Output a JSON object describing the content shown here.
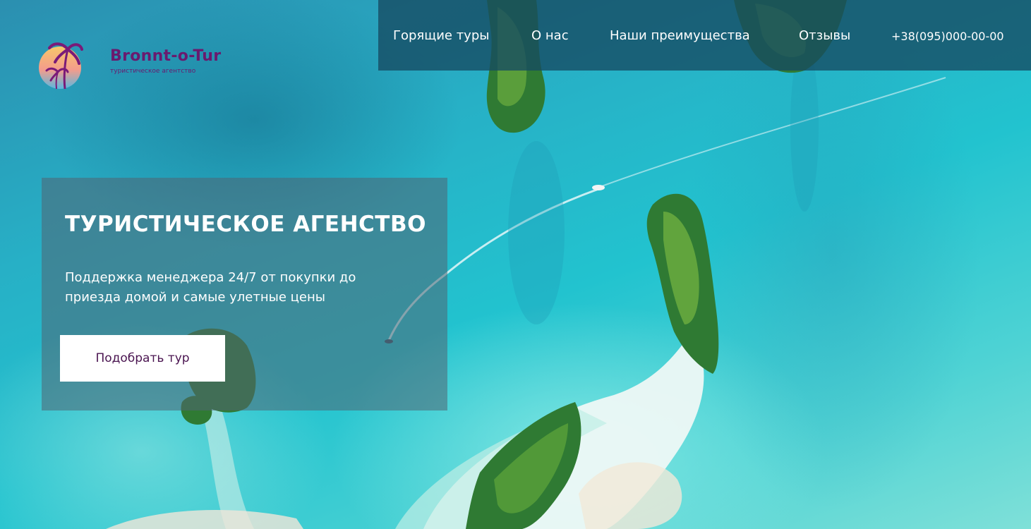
{
  "brand": {
    "name": "Bronnt-o-Tur",
    "tagline": "туристическое агентство",
    "color": "#6a1a6e"
  },
  "nav": {
    "items": [
      {
        "label": "Горящие туры"
      },
      {
        "label": "О нас"
      },
      {
        "label": "Наши преимущества"
      },
      {
        "label": "Отзывы"
      }
    ],
    "phone": "+38(095)000-00-00"
  },
  "hero": {
    "title": "ТУРИСТИЧЕСКОЕ АГЕНСТВО",
    "text": "Поддержка менеджера 24/7 от покупки до приезда домой и самые улетные цены",
    "button_label": "Подобрать тур",
    "background": "aerial-turquoise-sea-with-islands"
  },
  "colors": {
    "accent": "#4a1450",
    "nav_bg": "#164a62",
    "sea": "#22c3cf"
  }
}
